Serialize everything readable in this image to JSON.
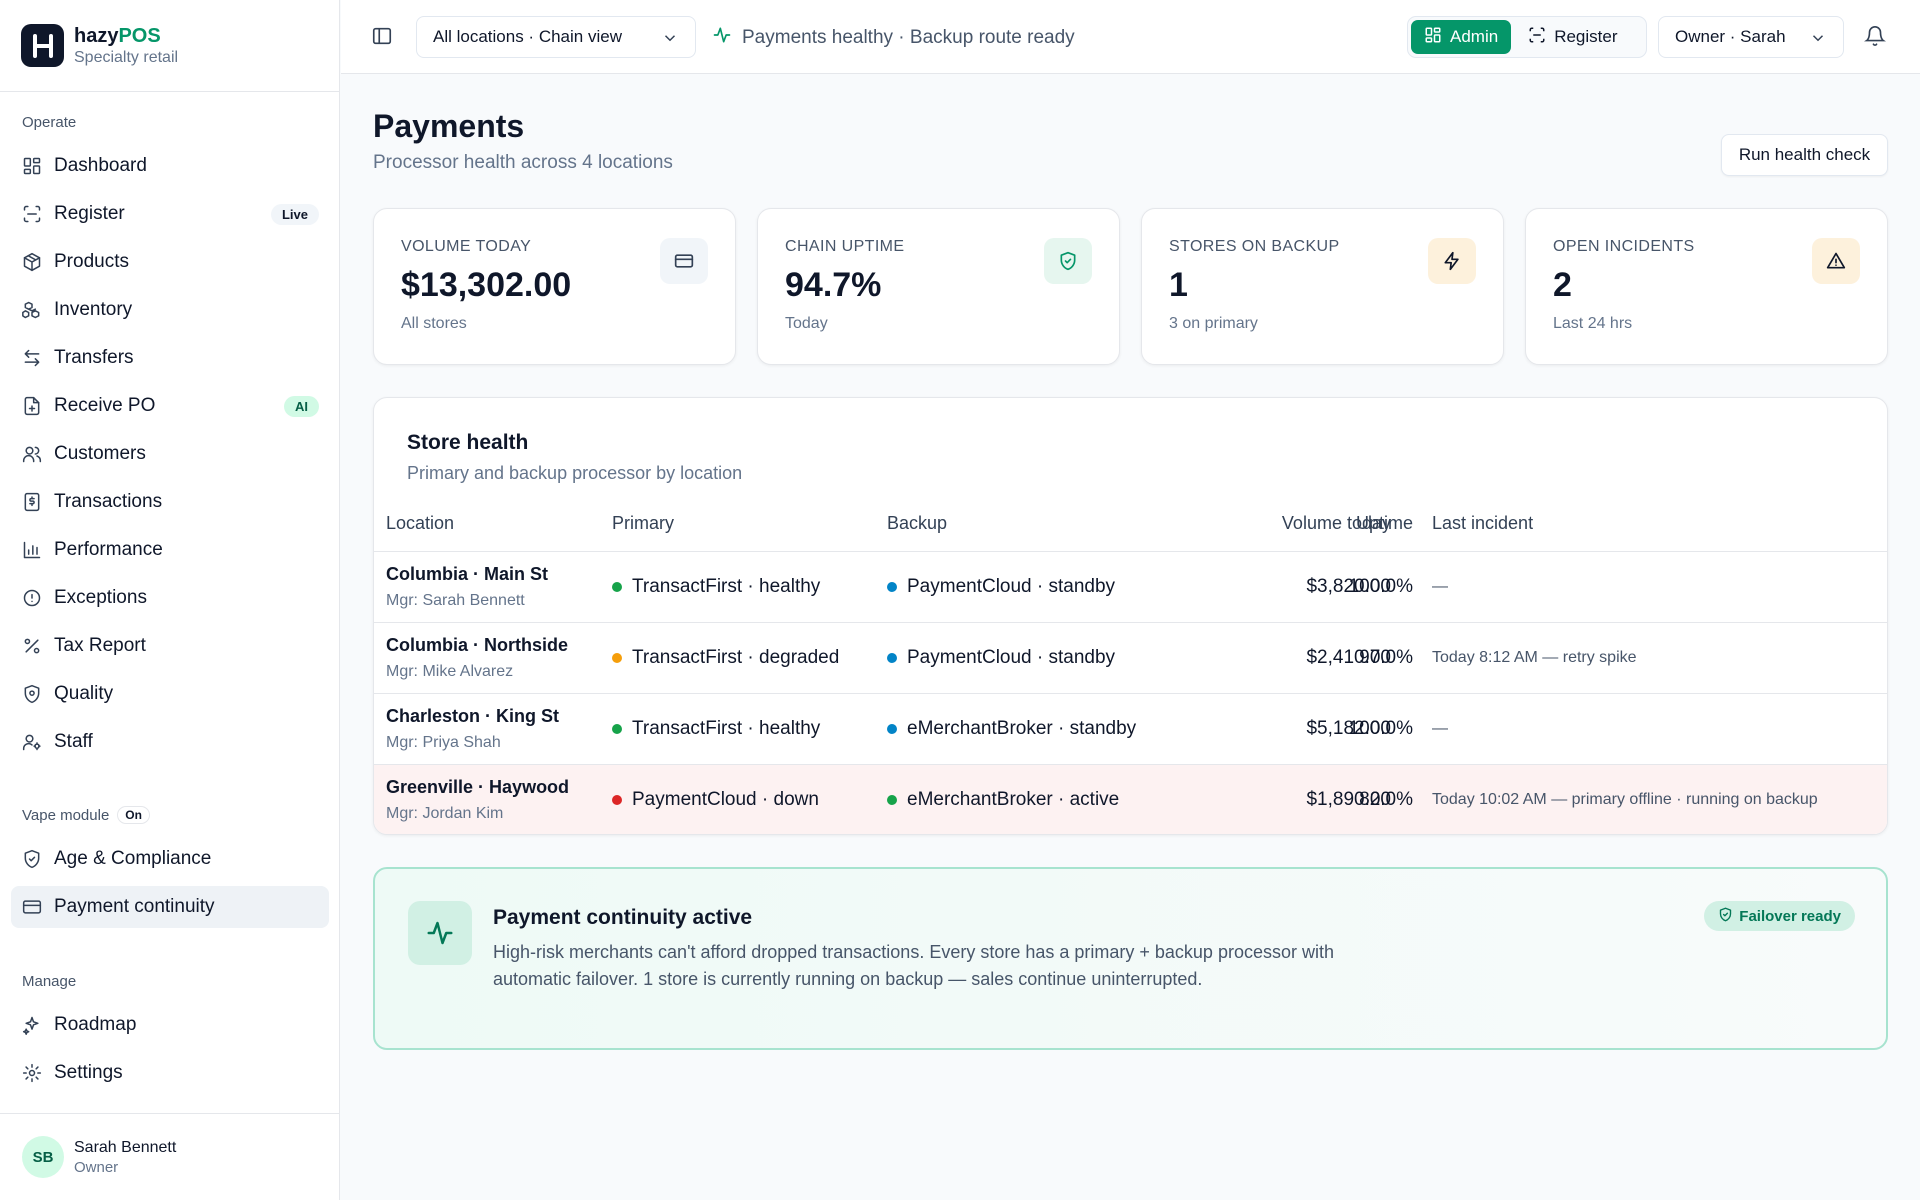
{
  "brand": {
    "name_main": "hazy",
    "name_accent": "POS",
    "subtitle": "Specialty retail"
  },
  "sidebar": {
    "section_operate": "Operate",
    "operate_items": [
      {
        "label": "Dashboard",
        "icon": "dashboard-icon"
      },
      {
        "label": "Register",
        "icon": "scan-icon",
        "badge": "Live"
      },
      {
        "label": "Products",
        "icon": "package-icon"
      },
      {
        "label": "Inventory",
        "icon": "boxes-icon"
      },
      {
        "label": "Transfers",
        "icon": "arrows-swap-icon"
      },
      {
        "label": "Receive PO",
        "icon": "file-plus-icon",
        "badge": "AI"
      },
      {
        "label": "Customers",
        "icon": "users-icon"
      },
      {
        "label": "Transactions",
        "icon": "receipt-icon"
      },
      {
        "label": "Performance",
        "icon": "bar-chart-icon"
      },
      {
        "label": "Exceptions",
        "icon": "alert-circle-icon"
      },
      {
        "label": "Tax Report",
        "icon": "percent-icon"
      },
      {
        "label": "Quality",
        "icon": "shield-icon"
      },
      {
        "label": "Staff",
        "icon": "user-cog-icon"
      }
    ],
    "section_vape": "Vape module",
    "vape_badge": "On",
    "vape_items": [
      {
        "label": "Age & Compliance",
        "icon": "shield-check-icon"
      },
      {
        "label": "Payment continuity",
        "icon": "credit-card-icon",
        "active": true
      }
    ],
    "section_manage": "Manage",
    "manage_items": [
      {
        "label": "Roadmap",
        "icon": "sparkles-icon"
      },
      {
        "label": "Settings",
        "icon": "gear-icon"
      }
    ],
    "user": {
      "initials": "SB",
      "name": "Sarah Bennett",
      "role": "Owner"
    }
  },
  "topbar": {
    "location_select": "All locations · Chain view",
    "status_text": "Payments healthy · Backup route ready",
    "role_admin": "Admin",
    "role_register": "Register",
    "owner_select": "Owner · Sarah"
  },
  "page": {
    "title": "Payments",
    "subtitle": "Processor health across 4 locations",
    "run_button": "Run health check"
  },
  "kpis": [
    {
      "label": "VOLUME TODAY",
      "value": "$13,302.00",
      "note": "All stores",
      "icon": "credit-card-icon",
      "color": "#475569",
      "bg": "#f1f5f9"
    },
    {
      "label": "CHAIN UPTIME",
      "value": "94.7%",
      "note": "Today",
      "icon": "shield-check-icon",
      "color": "#059669",
      "bg": "#e6f6ef"
    },
    {
      "label": "STORES ON BACKUP",
      "value": "1",
      "note": "3 on primary",
      "icon": "lightning-icon",
      "color": "#0f172a",
      "bg": "#fdf1dc"
    },
    {
      "label": "OPEN INCIDENTS",
      "value": "2",
      "note": "Last 24 hrs",
      "icon": "warning-icon",
      "color": "#0f172a",
      "bg": "#fdf1dc"
    }
  ],
  "store_health": {
    "title": "Store health",
    "subtitle": "Primary and backup processor by location",
    "columns": [
      "Location",
      "Primary",
      "Backup",
      "Volume today",
      "Uptime",
      "Last incident"
    ],
    "rows": [
      {
        "location": "Columbia · Main St",
        "manager": "Mgr: Sarah Bennett",
        "primary": "TransactFirst · healthy",
        "primary_color": "#16a34a",
        "backup": "PaymentCloud · standby",
        "backup_color": "#0284c7",
        "volume": "$3,820.00",
        "uptime": "100.0%",
        "incident": "—"
      },
      {
        "location": "Columbia · Northside",
        "manager": "Mgr: Mike Alvarez",
        "primary": "TransactFirst · degraded",
        "primary_color": "#f59e0b",
        "backup": "PaymentCloud · standby",
        "backup_color": "#0284c7",
        "volume": "$2,410.00",
        "uptime": "97.0%",
        "incident": "Today 8:12 AM — retry spike"
      },
      {
        "location": "Charleston · King St",
        "manager": "Mgr: Priya Shah",
        "primary": "TransactFirst · healthy",
        "primary_color": "#16a34a",
        "backup": "eMerchantBroker · standby",
        "backup_color": "#0284c7",
        "volume": "$5,182.00",
        "uptime": "100.0%",
        "incident": "—"
      },
      {
        "location": "Greenville · Haywood",
        "manager": "Mgr: Jordan Kim",
        "primary": "PaymentCloud · down",
        "primary_color": "#dc2626",
        "backup": "eMerchantBroker · active",
        "backup_color": "#16a34a",
        "volume": "$1,890.00",
        "uptime": "82.0%",
        "incident": "Today 10:02 AM — primary offline · running on backup"
      }
    ]
  },
  "continuity": {
    "title": "Payment continuity active",
    "text": "High-risk merchants can't afford dropped transactions. Every store has a primary + backup processor with automatic failover. 1 store is currently running on backup — sales continue uninterrupted.",
    "badge": "Failover ready"
  }
}
